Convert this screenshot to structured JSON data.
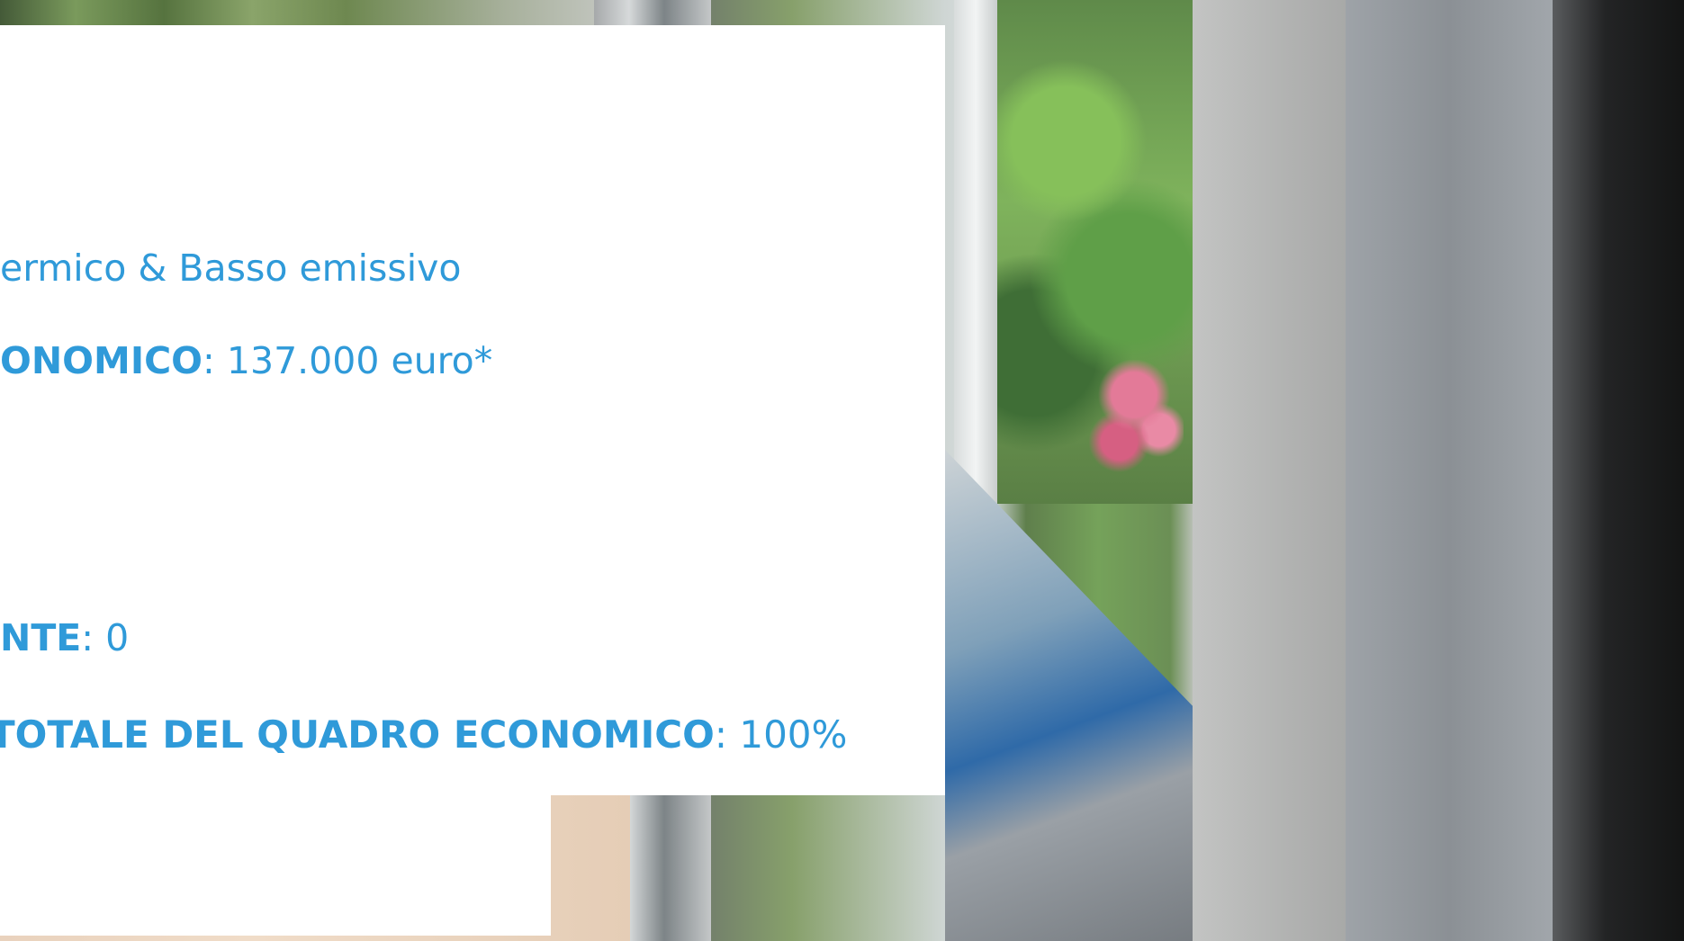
{
  "background": {
    "description_icon": "window-photo"
  },
  "content": {
    "line1": {
      "text": "Termico & Basso emissivo"
    },
    "line2": {
      "label": "QUADRO ECONOMICO",
      "separator": ":",
      "value": " 137.000 euro*"
    },
    "line3": {
      "label": "QUOTA COFINANZIAMENTO RICHIEDENTE",
      "separator": ":",
      "value": " 0"
    },
    "line4": {
      "label": "% FINANZIAMENTO SUL TOTALE DEL QUADRO ECONOMICO",
      "separator": ":",
      "value": " 100%"
    }
  },
  "colors": {
    "text": "#2f9ad9",
    "card": "#ffffff"
  }
}
